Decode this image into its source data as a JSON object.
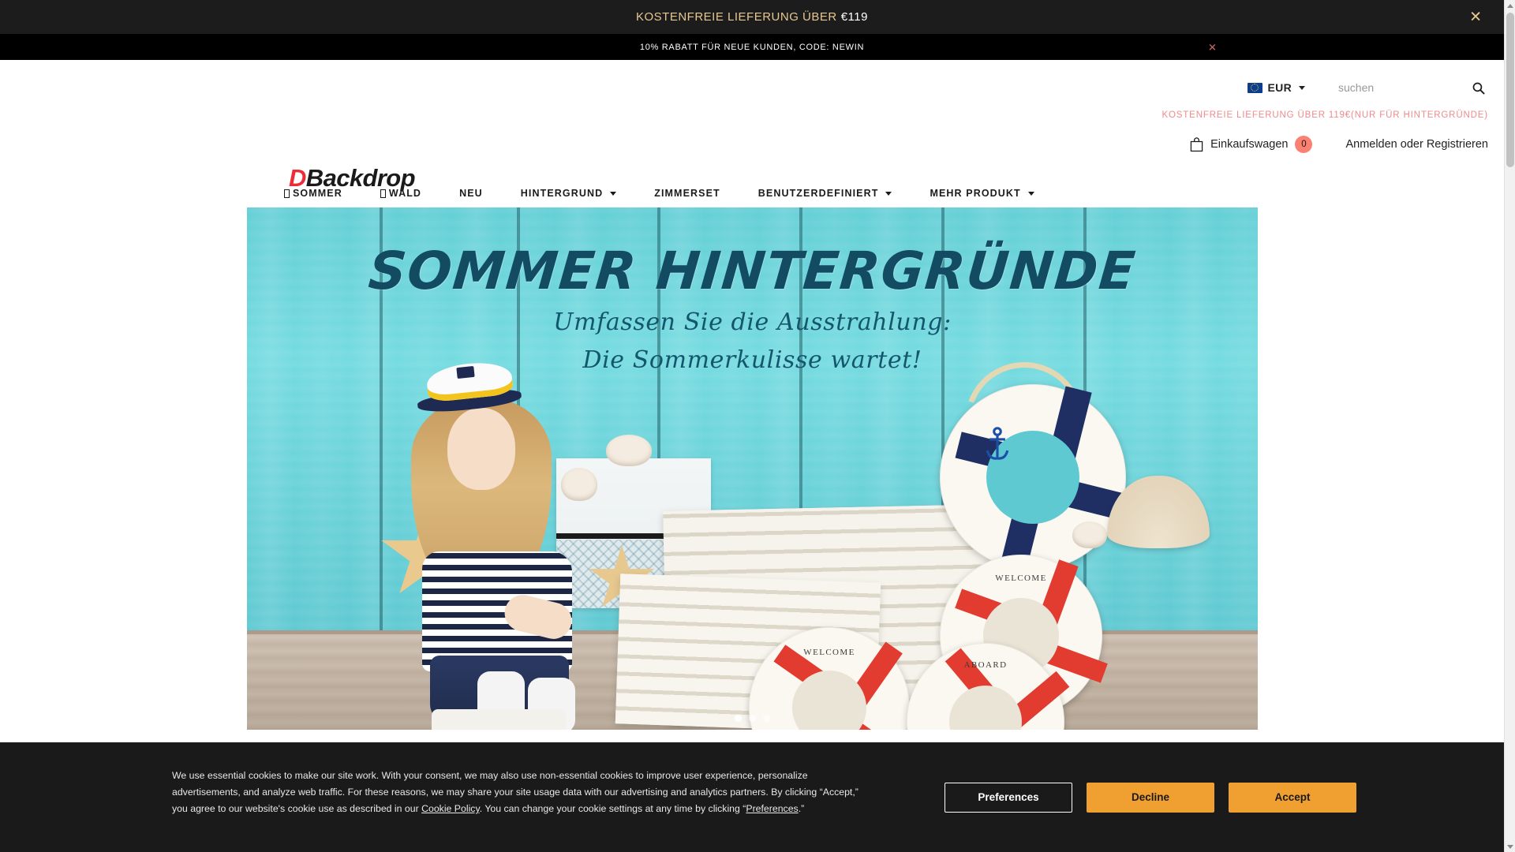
{
  "promo_top": {
    "text_highlight": "KOSTENFREIE LIEFERUNG ÜBER",
    "text_amount": "€119",
    "close_icon": "close-icon"
  },
  "promo_second": {
    "text": "10% RABATT FÜR NEUE KUNDEN, CODE: NEWIN",
    "close_icon": "close-icon"
  },
  "header": {
    "logo_initial": "D",
    "logo_rest": "Backdrop",
    "currency": {
      "flag": "eu-flag-icon",
      "label": "EUR",
      "caret": "chevron-down-icon"
    },
    "search": {
      "placeholder": "suchen",
      "value": "",
      "icon": "search-icon"
    },
    "shipping_note": "KOSTENFREIE LIEFERUNG ÜBER 119€(NUR FÜR HINTERGRÜNDE)",
    "cart": {
      "icon": "shopping-bag-icon",
      "label": "Einkaufswagen",
      "count": "0"
    },
    "account_label": "Anmelden oder Registrieren"
  },
  "nav": {
    "items": [
      {
        "label": "SOMMER",
        "has_glyph": true,
        "has_caret": false
      },
      {
        "label": "WALD",
        "has_glyph": true,
        "has_caret": false
      },
      {
        "label": "NEU",
        "has_glyph": false,
        "has_caret": false
      },
      {
        "label": "HINTERGRUND",
        "has_glyph": false,
        "has_caret": true
      },
      {
        "label": "ZIMMERSET",
        "has_glyph": false,
        "has_caret": false
      },
      {
        "label": "BENUTZERDEFINIERT",
        "has_glyph": false,
        "has_caret": true
      },
      {
        "label": "MEHR PRODUKT",
        "has_glyph": false,
        "has_caret": true
      }
    ]
  },
  "hero": {
    "title": "SOMMER HINTERGRÜNDE",
    "subtitle_1": "Umfassen Sie die Ausstrahlung:",
    "subtitle_2": "Die Sommerkulisse wartet!",
    "ring_labels": {
      "top_welcome": "WELCOME",
      "bottom_welcome": "WELCOME",
      "aboard": "ABOARD"
    }
  },
  "cookie": {
    "paragraph_1": "We use essential cookies to make our site work. With your consent, we may also use non-essential cookies to improve user experience, personalize advertisements, and analyze web traffic. For these reasons, we may share your site usage data with our advertising and analytics partners. By clicking “Accept,” you agree to our website's cookie use as described in our ",
    "link_cookie_policy": "Cookie Policy",
    "paragraph_2": ". You can change your cookie settings at any time by clicking “",
    "link_preferences": "Preferences",
    "paragraph_3": ".”",
    "btn_preferences": "Preferences",
    "btn_decline": "Decline",
    "btn_accept": "Accept"
  },
  "colors": {
    "promo_gold": "#e6c892",
    "logo_red": "#ee2b36",
    "shipping_pink": "#f08a8a",
    "cart_badge": "#fa8072",
    "cookie_btn_orange": "#f0a030",
    "hero_teal": "#63cfd6",
    "hero_text_navy": "#134b63"
  }
}
